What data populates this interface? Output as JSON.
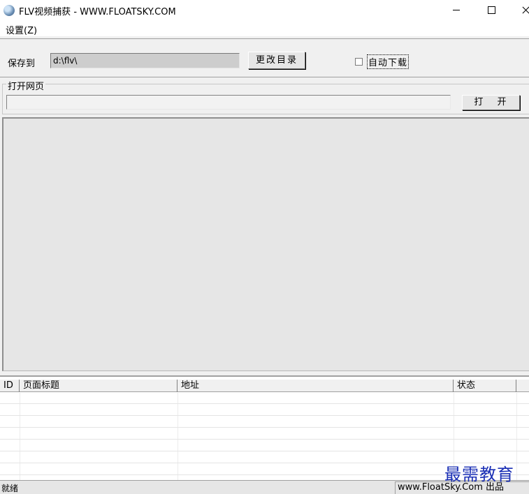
{
  "window": {
    "title": "FLV视频捕获 - WWW.FLOATSKY.COM",
    "icon": "app-globe-icon"
  },
  "menu": {
    "settings": "设置(Z)"
  },
  "save": {
    "label": "保存到",
    "path": "d:\\flv\\",
    "change_dir_button": "更改目录"
  },
  "auto_download": {
    "label": "自动下载",
    "checked": false
  },
  "open_page": {
    "group_label": "打开网页",
    "url_value": "",
    "open_button": "打 开"
  },
  "list": {
    "columns": [
      "ID",
      "页面标题",
      "地址",
      "状态"
    ],
    "rows": []
  },
  "status": {
    "left": "就绪",
    "right": "www.FloatSky.Com 出品"
  },
  "watermark": "最需教育"
}
